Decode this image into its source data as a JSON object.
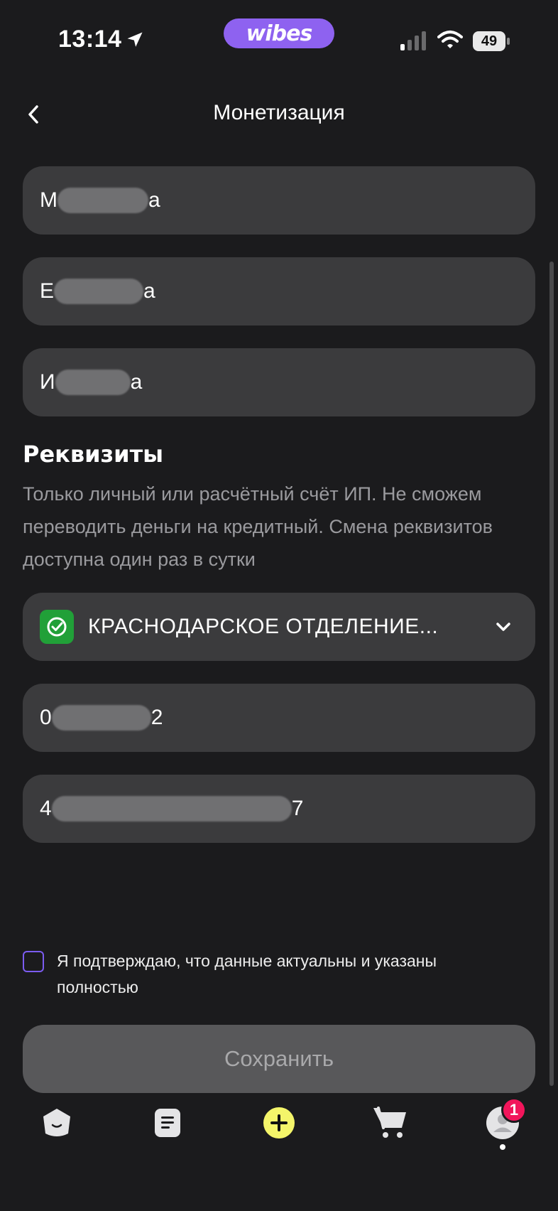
{
  "status_bar": {
    "time": "13:14",
    "app_pill": "wibes",
    "battery": "49"
  },
  "header": {
    "title": "Монетизация"
  },
  "fields": [
    {
      "first": "М",
      "last": "а"
    },
    {
      "first": "Е",
      "last": "а"
    },
    {
      "first": "И",
      "last": "а"
    }
  ],
  "requisites": {
    "title": "Реквизиты",
    "description": "Только личный или расчётный счёт ИП. Не сможем переводить деньги на кредитный. Смена реквизитов доступна один раз в сутки",
    "bank": "КРАСНОДАРСКОЕ ОТДЕЛЕНИЕ...",
    "bik": {
      "first": "0",
      "last": "2"
    },
    "account": {
      "first": "4",
      "last": "7"
    }
  },
  "confirm_text": "Я подтверждаю, что данные актуальны и указаны полностью",
  "save_label": "Сохранить",
  "tabbar": {
    "badge": "1"
  },
  "colors": {
    "accent": "#8e62f0",
    "bank_green": "#21a038",
    "badge": "#f2155b",
    "add_yellow": "#f4f56a"
  }
}
